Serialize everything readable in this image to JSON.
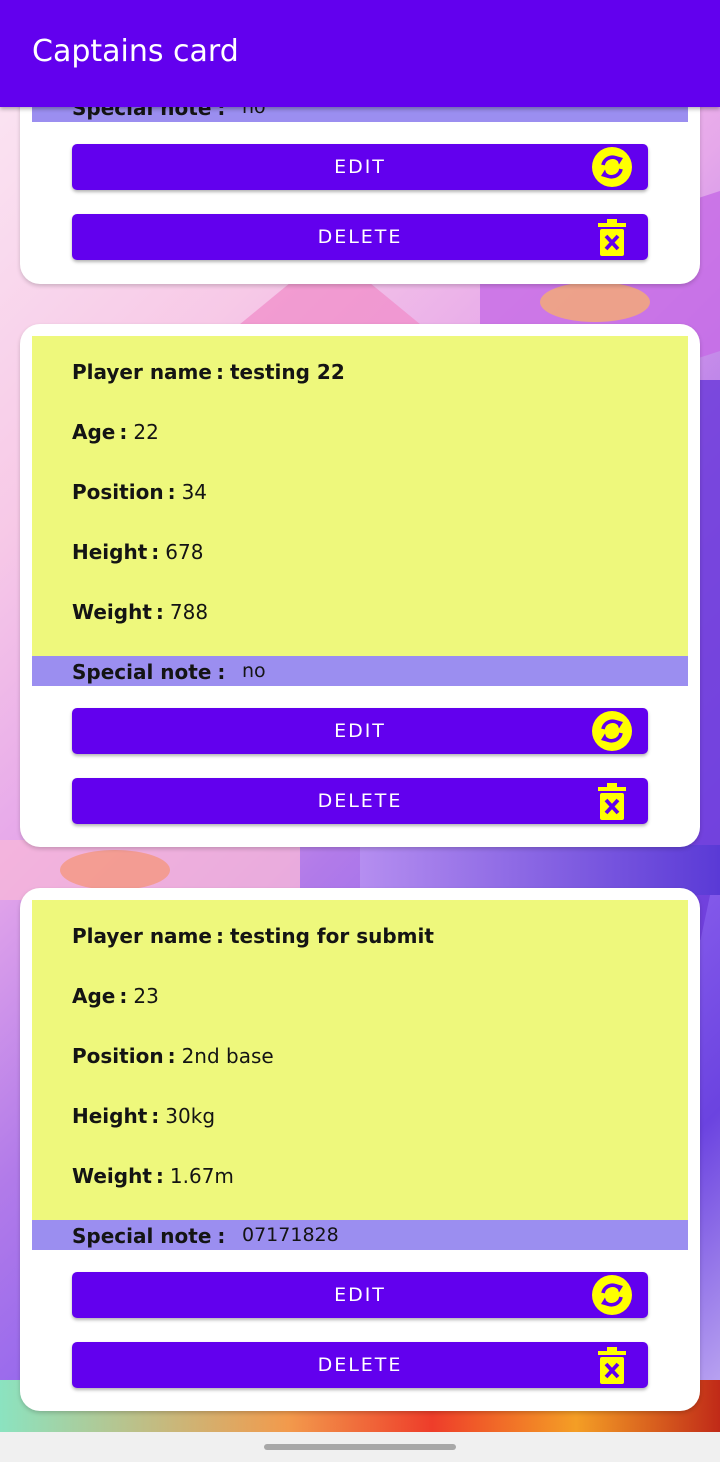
{
  "app_bar": {
    "title": "Captains card"
  },
  "labels": {
    "player_name": "Player name",
    "age": "Age",
    "position": "Position",
    "height": "Height",
    "weight": "Weight",
    "special_note": "Special note",
    "separator": ":"
  },
  "buttons": {
    "edit": "EDIT",
    "delete": "DELETE"
  },
  "icons": {
    "edit": "sync-icon",
    "delete": "delete-x-icon",
    "edit_color": "#ffff00",
    "delete_color": "#ffff00"
  },
  "colors": {
    "app_bar": "#6200ee",
    "button": "#6200ee",
    "info_panel": "#eef87c",
    "note_panel": "#9b8ef0"
  },
  "cards": [
    {
      "special_note": "no"
    },
    {
      "player_name": "testing 22",
      "age": "22",
      "position": "34",
      "height": "678",
      "weight": "788",
      "special_note": "no"
    },
    {
      "player_name": "testing for submit",
      "age": "23",
      "position": "2nd base",
      "height": "30kg",
      "weight": "1.67m",
      "special_note": "07171828"
    }
  ]
}
